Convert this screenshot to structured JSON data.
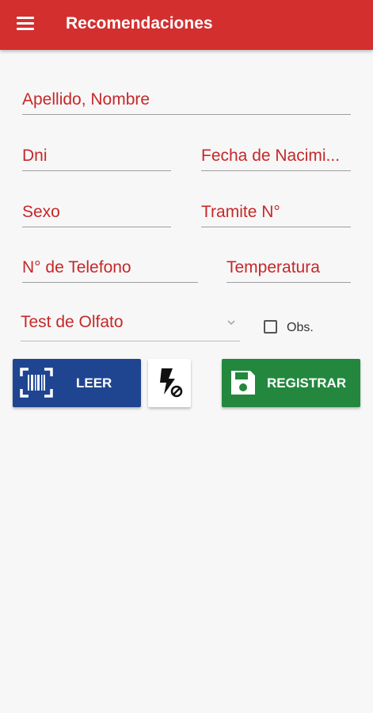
{
  "appbar": {
    "title": "Recomendaciones",
    "menu_icon": "hamburger-menu-icon",
    "color": "#d32f2f"
  },
  "form": {
    "apellido_nombre": {
      "placeholder": "Apellido, Nombre",
      "value": ""
    },
    "dni": {
      "placeholder": "Dni",
      "value": ""
    },
    "fecha_nacimiento": {
      "placeholder": "Fecha de Nacimi...",
      "value": ""
    },
    "sexo": {
      "placeholder": "Sexo",
      "value": ""
    },
    "tramite": {
      "placeholder": "Tramite N°",
      "value": ""
    },
    "telefono": {
      "placeholder": "N° de Telefono",
      "value": ""
    },
    "temperatura": {
      "placeholder": "Temperatura",
      "value": ""
    },
    "test_olfato": {
      "selected": "Test de Olfato",
      "icon": "chevron-down-icon"
    },
    "obs": {
      "label": "Obs.",
      "checked": false
    }
  },
  "actions": {
    "leer": {
      "label": "LEER",
      "icon": "barcode-scan-icon",
      "color": "#1f4591"
    },
    "flash": {
      "icon": "flash-off-icon"
    },
    "registrar": {
      "label": "REGISTRAR",
      "icon": "floppy-disk-icon",
      "color": "#23883e"
    }
  }
}
